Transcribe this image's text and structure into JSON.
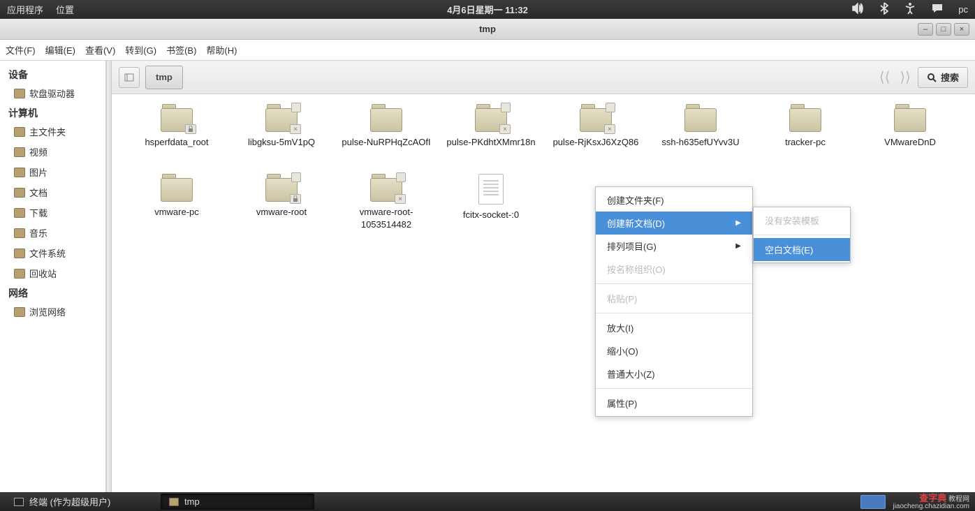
{
  "topbar": {
    "applications": "应用程序",
    "places": "位置",
    "clock": "4月6日星期一 11:32",
    "user": "pc"
  },
  "window": {
    "title": "tmp",
    "buttons": {
      "min": "–",
      "max": "□",
      "close": "×"
    }
  },
  "menubar": [
    "文件(F)",
    "编辑(E)",
    "查看(V)",
    "转到(G)",
    "书签(B)",
    "帮助(H)"
  ],
  "sidebar": {
    "sections": [
      {
        "header": "设备",
        "items": [
          {
            "label": "软盘驱动器"
          }
        ]
      },
      {
        "header": "计算机",
        "items": [
          {
            "label": "主文件夹"
          },
          {
            "label": "视频"
          },
          {
            "label": "图片"
          },
          {
            "label": "文档"
          },
          {
            "label": "下载"
          },
          {
            "label": "音乐"
          },
          {
            "label": "文件系统"
          },
          {
            "label": "回收站"
          }
        ]
      },
      {
        "header": "网络",
        "items": [
          {
            "label": "浏览网络"
          }
        ]
      }
    ]
  },
  "toolbar": {
    "breadcrumb": "tmp",
    "search": "搜索"
  },
  "files": [
    {
      "name": "hsperfdata_root",
      "type": "folder",
      "locked": false,
      "readonly": true
    },
    {
      "name": "libgksu-5mV1pQ",
      "type": "folder",
      "locked": true,
      "noaccess": true
    },
    {
      "name": "pulse-NuRPHqZcAOfI",
      "type": "folder",
      "locked": false,
      "readonly": false
    },
    {
      "name": "pulse-PKdhtXMmr18n",
      "type": "folder",
      "locked": true,
      "noaccess": true
    },
    {
      "name": "pulse-RjKsxJ6XzQ86",
      "type": "folder",
      "locked": true,
      "noaccess": true
    },
    {
      "name": "ssh-h635efUYvv3U",
      "type": "folder",
      "locked": false,
      "readonly": false
    },
    {
      "name": "tracker-pc",
      "type": "folder",
      "locked": false,
      "readonly": false
    },
    {
      "name": "VMwareDnD",
      "type": "folder",
      "locked": false,
      "readonly": false
    },
    {
      "name": "vmware-pc",
      "type": "folder",
      "locked": false,
      "readonly": false
    },
    {
      "name": "vmware-root",
      "type": "folder",
      "locked": true,
      "readonly": true
    },
    {
      "name": "vmware-root-1053514482",
      "type": "folder",
      "locked": true,
      "noaccess": true
    },
    {
      "name": "fcitx-socket-:0",
      "type": "file"
    }
  ],
  "context_menu": [
    {
      "label": "创建文件夹(F)",
      "type": "item"
    },
    {
      "label": "创建新文档(D)",
      "type": "item",
      "submenu": true,
      "highlighted": true
    },
    {
      "label": "排列项目(G)",
      "type": "item",
      "submenu": true
    },
    {
      "label": "按名称组织(O)",
      "type": "item",
      "disabled": true
    },
    {
      "type": "sep"
    },
    {
      "label": "粘贴(P)",
      "type": "item",
      "disabled": true
    },
    {
      "type": "sep"
    },
    {
      "label": "放大(I)",
      "type": "item"
    },
    {
      "label": "缩小(O)",
      "type": "item"
    },
    {
      "label": "普通大小(Z)",
      "type": "item"
    },
    {
      "type": "sep"
    },
    {
      "label": "属性(P)",
      "type": "item"
    }
  ],
  "submenu": [
    {
      "label": "没有安装模板",
      "disabled": true
    },
    {
      "type": "sep"
    },
    {
      "label": "空白文档(E)",
      "highlighted": true
    }
  ],
  "taskbar": {
    "items": [
      {
        "label": "终端 (作为超级用户)",
        "icon": "terminal"
      },
      {
        "label": "tmp",
        "icon": "folder",
        "active": true
      }
    ]
  },
  "watermark": {
    "brand": "查字典",
    "sub1": "教程网",
    "sub2": "jiaocheng.chazidian.com"
  }
}
